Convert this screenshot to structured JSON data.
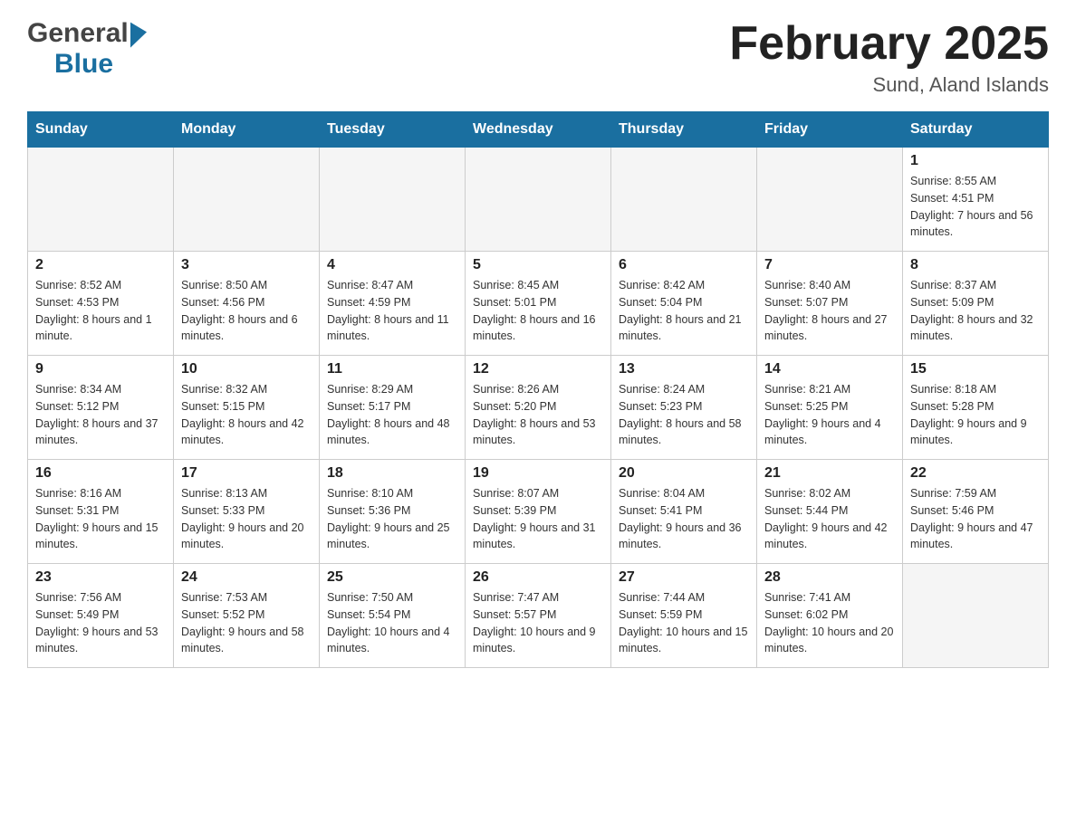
{
  "logo": {
    "general": "General",
    "blue": "Blue"
  },
  "title": "February 2025",
  "location": "Sund, Aland Islands",
  "weekdays": [
    "Sunday",
    "Monday",
    "Tuesday",
    "Wednesday",
    "Thursday",
    "Friday",
    "Saturday"
  ],
  "weeks": [
    [
      {
        "day": "",
        "sunrise": "",
        "sunset": "",
        "daylight": ""
      },
      {
        "day": "",
        "sunrise": "",
        "sunset": "",
        "daylight": ""
      },
      {
        "day": "",
        "sunrise": "",
        "sunset": "",
        "daylight": ""
      },
      {
        "day": "",
        "sunrise": "",
        "sunset": "",
        "daylight": ""
      },
      {
        "day": "",
        "sunrise": "",
        "sunset": "",
        "daylight": ""
      },
      {
        "day": "",
        "sunrise": "",
        "sunset": "",
        "daylight": ""
      },
      {
        "day": "1",
        "sunrise": "Sunrise: 8:55 AM",
        "sunset": "Sunset: 4:51 PM",
        "daylight": "Daylight: 7 hours and 56 minutes."
      }
    ],
    [
      {
        "day": "2",
        "sunrise": "Sunrise: 8:52 AM",
        "sunset": "Sunset: 4:53 PM",
        "daylight": "Daylight: 8 hours and 1 minute."
      },
      {
        "day": "3",
        "sunrise": "Sunrise: 8:50 AM",
        "sunset": "Sunset: 4:56 PM",
        "daylight": "Daylight: 8 hours and 6 minutes."
      },
      {
        "day": "4",
        "sunrise": "Sunrise: 8:47 AM",
        "sunset": "Sunset: 4:59 PM",
        "daylight": "Daylight: 8 hours and 11 minutes."
      },
      {
        "day": "5",
        "sunrise": "Sunrise: 8:45 AM",
        "sunset": "Sunset: 5:01 PM",
        "daylight": "Daylight: 8 hours and 16 minutes."
      },
      {
        "day": "6",
        "sunrise": "Sunrise: 8:42 AM",
        "sunset": "Sunset: 5:04 PM",
        "daylight": "Daylight: 8 hours and 21 minutes."
      },
      {
        "day": "7",
        "sunrise": "Sunrise: 8:40 AM",
        "sunset": "Sunset: 5:07 PM",
        "daylight": "Daylight: 8 hours and 27 minutes."
      },
      {
        "day": "8",
        "sunrise": "Sunrise: 8:37 AM",
        "sunset": "Sunset: 5:09 PM",
        "daylight": "Daylight: 8 hours and 32 minutes."
      }
    ],
    [
      {
        "day": "9",
        "sunrise": "Sunrise: 8:34 AM",
        "sunset": "Sunset: 5:12 PM",
        "daylight": "Daylight: 8 hours and 37 minutes."
      },
      {
        "day": "10",
        "sunrise": "Sunrise: 8:32 AM",
        "sunset": "Sunset: 5:15 PM",
        "daylight": "Daylight: 8 hours and 42 minutes."
      },
      {
        "day": "11",
        "sunrise": "Sunrise: 8:29 AM",
        "sunset": "Sunset: 5:17 PM",
        "daylight": "Daylight: 8 hours and 48 minutes."
      },
      {
        "day": "12",
        "sunrise": "Sunrise: 8:26 AM",
        "sunset": "Sunset: 5:20 PM",
        "daylight": "Daylight: 8 hours and 53 minutes."
      },
      {
        "day": "13",
        "sunrise": "Sunrise: 8:24 AM",
        "sunset": "Sunset: 5:23 PM",
        "daylight": "Daylight: 8 hours and 58 minutes."
      },
      {
        "day": "14",
        "sunrise": "Sunrise: 8:21 AM",
        "sunset": "Sunset: 5:25 PM",
        "daylight": "Daylight: 9 hours and 4 minutes."
      },
      {
        "day": "15",
        "sunrise": "Sunrise: 8:18 AM",
        "sunset": "Sunset: 5:28 PM",
        "daylight": "Daylight: 9 hours and 9 minutes."
      }
    ],
    [
      {
        "day": "16",
        "sunrise": "Sunrise: 8:16 AM",
        "sunset": "Sunset: 5:31 PM",
        "daylight": "Daylight: 9 hours and 15 minutes."
      },
      {
        "day": "17",
        "sunrise": "Sunrise: 8:13 AM",
        "sunset": "Sunset: 5:33 PM",
        "daylight": "Daylight: 9 hours and 20 minutes."
      },
      {
        "day": "18",
        "sunrise": "Sunrise: 8:10 AM",
        "sunset": "Sunset: 5:36 PM",
        "daylight": "Daylight: 9 hours and 25 minutes."
      },
      {
        "day": "19",
        "sunrise": "Sunrise: 8:07 AM",
        "sunset": "Sunset: 5:39 PM",
        "daylight": "Daylight: 9 hours and 31 minutes."
      },
      {
        "day": "20",
        "sunrise": "Sunrise: 8:04 AM",
        "sunset": "Sunset: 5:41 PM",
        "daylight": "Daylight: 9 hours and 36 minutes."
      },
      {
        "day": "21",
        "sunrise": "Sunrise: 8:02 AM",
        "sunset": "Sunset: 5:44 PM",
        "daylight": "Daylight: 9 hours and 42 minutes."
      },
      {
        "day": "22",
        "sunrise": "Sunrise: 7:59 AM",
        "sunset": "Sunset: 5:46 PM",
        "daylight": "Daylight: 9 hours and 47 minutes."
      }
    ],
    [
      {
        "day": "23",
        "sunrise": "Sunrise: 7:56 AM",
        "sunset": "Sunset: 5:49 PM",
        "daylight": "Daylight: 9 hours and 53 minutes."
      },
      {
        "day": "24",
        "sunrise": "Sunrise: 7:53 AM",
        "sunset": "Sunset: 5:52 PM",
        "daylight": "Daylight: 9 hours and 58 minutes."
      },
      {
        "day": "25",
        "sunrise": "Sunrise: 7:50 AM",
        "sunset": "Sunset: 5:54 PM",
        "daylight": "Daylight: 10 hours and 4 minutes."
      },
      {
        "day": "26",
        "sunrise": "Sunrise: 7:47 AM",
        "sunset": "Sunset: 5:57 PM",
        "daylight": "Daylight: 10 hours and 9 minutes."
      },
      {
        "day": "27",
        "sunrise": "Sunrise: 7:44 AM",
        "sunset": "Sunset: 5:59 PM",
        "daylight": "Daylight: 10 hours and 15 minutes."
      },
      {
        "day": "28",
        "sunrise": "Sunrise: 7:41 AM",
        "sunset": "Sunset: 6:02 PM",
        "daylight": "Daylight: 10 hours and 20 minutes."
      },
      {
        "day": "",
        "sunrise": "",
        "sunset": "",
        "daylight": ""
      }
    ]
  ]
}
